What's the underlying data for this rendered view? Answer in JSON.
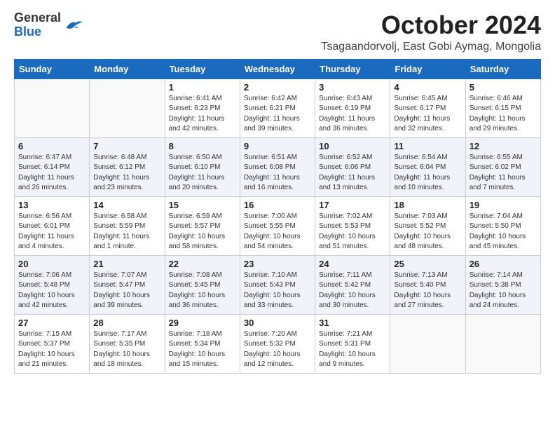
{
  "header": {
    "logo_general": "General",
    "logo_blue": "Blue",
    "month_title": "October 2024",
    "location": "Tsagaandorvolj, East Gobi Aymag, Mongolia"
  },
  "days_of_week": [
    "Sunday",
    "Monday",
    "Tuesday",
    "Wednesday",
    "Thursday",
    "Friday",
    "Saturday"
  ],
  "weeks": [
    [
      {
        "day": "",
        "info": ""
      },
      {
        "day": "",
        "info": ""
      },
      {
        "day": "1",
        "info": "Sunrise: 6:41 AM\nSunset: 6:23 PM\nDaylight: 11 hours\nand 42 minutes."
      },
      {
        "day": "2",
        "info": "Sunrise: 6:42 AM\nSunset: 6:21 PM\nDaylight: 11 hours\nand 39 minutes."
      },
      {
        "day": "3",
        "info": "Sunrise: 6:43 AM\nSunset: 6:19 PM\nDaylight: 11 hours\nand 36 minutes."
      },
      {
        "day": "4",
        "info": "Sunrise: 6:45 AM\nSunset: 6:17 PM\nDaylight: 11 hours\nand 32 minutes."
      },
      {
        "day": "5",
        "info": "Sunrise: 6:46 AM\nSunset: 6:15 PM\nDaylight: 11 hours\nand 29 minutes."
      }
    ],
    [
      {
        "day": "6",
        "info": "Sunrise: 6:47 AM\nSunset: 6:14 PM\nDaylight: 11 hours\nand 26 minutes."
      },
      {
        "day": "7",
        "info": "Sunrise: 6:48 AM\nSunset: 6:12 PM\nDaylight: 11 hours\nand 23 minutes."
      },
      {
        "day": "8",
        "info": "Sunrise: 6:50 AM\nSunset: 6:10 PM\nDaylight: 11 hours\nand 20 minutes."
      },
      {
        "day": "9",
        "info": "Sunrise: 6:51 AM\nSunset: 6:08 PM\nDaylight: 11 hours\nand 16 minutes."
      },
      {
        "day": "10",
        "info": "Sunrise: 6:52 AM\nSunset: 6:06 PM\nDaylight: 11 hours\nand 13 minutes."
      },
      {
        "day": "11",
        "info": "Sunrise: 6:54 AM\nSunset: 6:04 PM\nDaylight: 11 hours\nand 10 minutes."
      },
      {
        "day": "12",
        "info": "Sunrise: 6:55 AM\nSunset: 6:02 PM\nDaylight: 11 hours\nand 7 minutes."
      }
    ],
    [
      {
        "day": "13",
        "info": "Sunrise: 6:56 AM\nSunset: 6:01 PM\nDaylight: 11 hours\nand 4 minutes."
      },
      {
        "day": "14",
        "info": "Sunrise: 6:58 AM\nSunset: 5:59 PM\nDaylight: 11 hours\nand 1 minute."
      },
      {
        "day": "15",
        "info": "Sunrise: 6:59 AM\nSunset: 5:57 PM\nDaylight: 10 hours\nand 58 minutes."
      },
      {
        "day": "16",
        "info": "Sunrise: 7:00 AM\nSunset: 5:55 PM\nDaylight: 10 hours\nand 54 minutes."
      },
      {
        "day": "17",
        "info": "Sunrise: 7:02 AM\nSunset: 5:53 PM\nDaylight: 10 hours\nand 51 minutes."
      },
      {
        "day": "18",
        "info": "Sunrise: 7:03 AM\nSunset: 5:52 PM\nDaylight: 10 hours\nand 48 minutes."
      },
      {
        "day": "19",
        "info": "Sunrise: 7:04 AM\nSunset: 5:50 PM\nDaylight: 10 hours\nand 45 minutes."
      }
    ],
    [
      {
        "day": "20",
        "info": "Sunrise: 7:06 AM\nSunset: 5:48 PM\nDaylight: 10 hours\nand 42 minutes."
      },
      {
        "day": "21",
        "info": "Sunrise: 7:07 AM\nSunset: 5:47 PM\nDaylight: 10 hours\nand 39 minutes."
      },
      {
        "day": "22",
        "info": "Sunrise: 7:08 AM\nSunset: 5:45 PM\nDaylight: 10 hours\nand 36 minutes."
      },
      {
        "day": "23",
        "info": "Sunrise: 7:10 AM\nSunset: 5:43 PM\nDaylight: 10 hours\nand 33 minutes."
      },
      {
        "day": "24",
        "info": "Sunrise: 7:11 AM\nSunset: 5:42 PM\nDaylight: 10 hours\nand 30 minutes."
      },
      {
        "day": "25",
        "info": "Sunrise: 7:13 AM\nSunset: 5:40 PM\nDaylight: 10 hours\nand 27 minutes."
      },
      {
        "day": "26",
        "info": "Sunrise: 7:14 AM\nSunset: 5:38 PM\nDaylight: 10 hours\nand 24 minutes."
      }
    ],
    [
      {
        "day": "27",
        "info": "Sunrise: 7:15 AM\nSunset: 5:37 PM\nDaylight: 10 hours\nand 21 minutes."
      },
      {
        "day": "28",
        "info": "Sunrise: 7:17 AM\nSunset: 5:35 PM\nDaylight: 10 hours\nand 18 minutes."
      },
      {
        "day": "29",
        "info": "Sunrise: 7:18 AM\nSunset: 5:34 PM\nDaylight: 10 hours\nand 15 minutes."
      },
      {
        "day": "30",
        "info": "Sunrise: 7:20 AM\nSunset: 5:32 PM\nDaylight: 10 hours\nand 12 minutes."
      },
      {
        "day": "31",
        "info": "Sunrise: 7:21 AM\nSunset: 5:31 PM\nDaylight: 10 hours\nand 9 minutes."
      },
      {
        "day": "",
        "info": ""
      },
      {
        "day": "",
        "info": ""
      }
    ]
  ]
}
